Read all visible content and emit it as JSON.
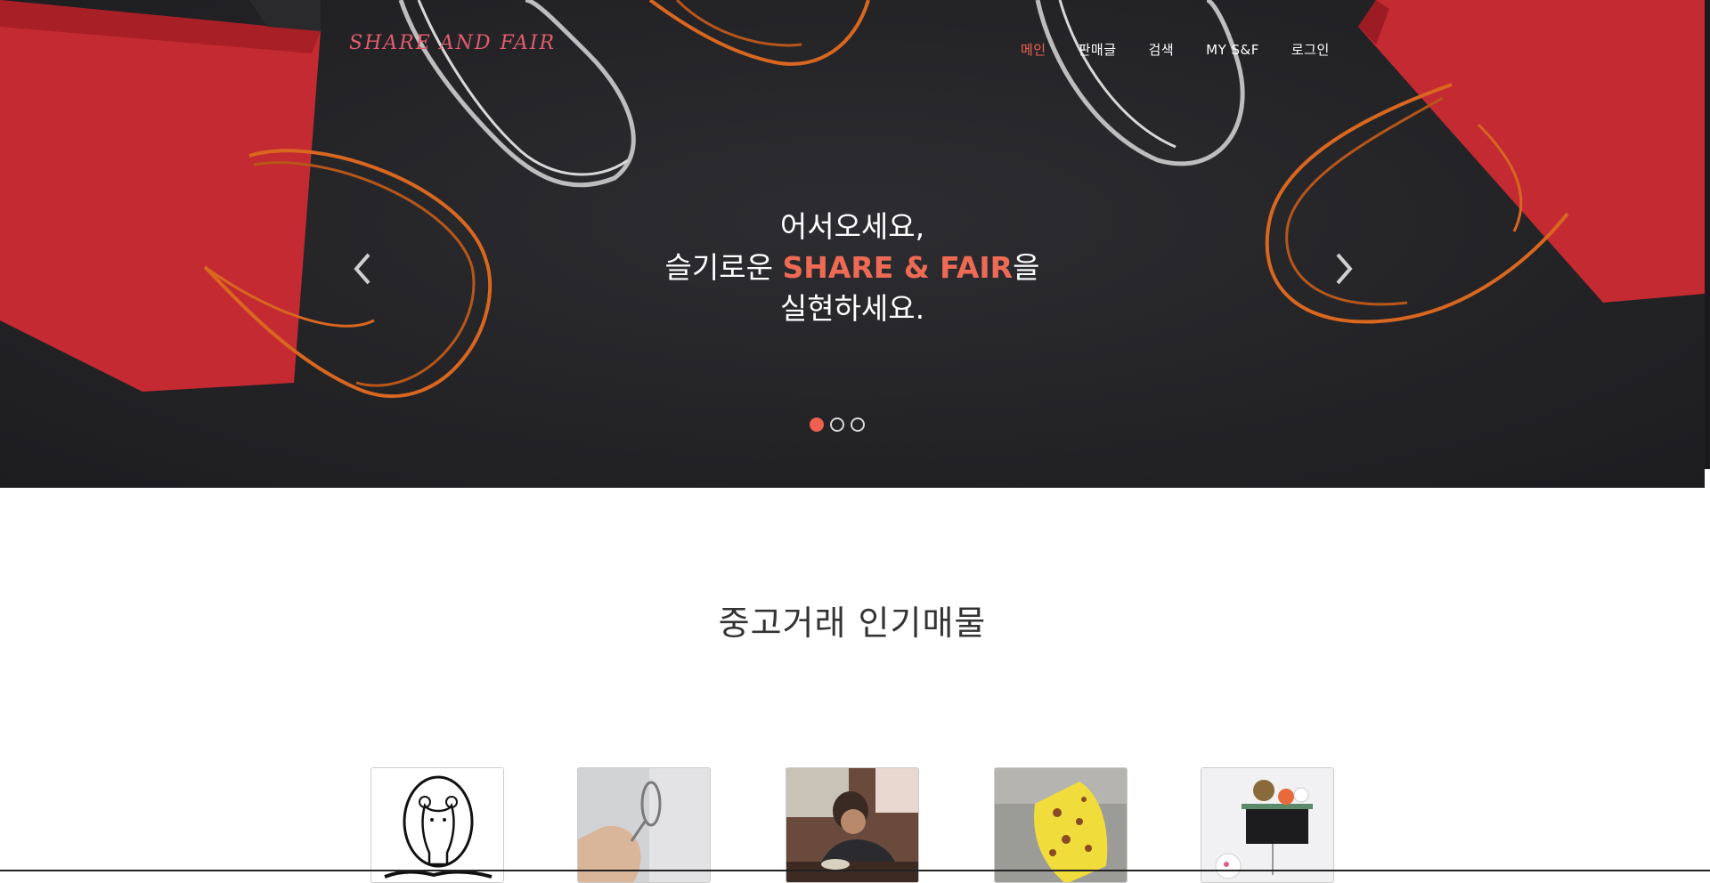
{
  "navbar": {
    "brand": "SHARE AND FAIR",
    "items": [
      {
        "label": "메인",
        "active": true
      },
      {
        "label": "판매글",
        "active": false
      },
      {
        "label": "검색",
        "active": false
      },
      {
        "label": "MY S&F",
        "active": false
      },
      {
        "label": "로그인",
        "active": false
      }
    ]
  },
  "hero": {
    "line1": "어서오세요,",
    "line2_prefix": "슬기로운 ",
    "line2_accent": "SHARE & FAIR",
    "line2_suffix": "을",
    "line3": "실현하세요.",
    "slides_count": 3,
    "active_slide": 1,
    "prev_icon": "chevron-left-icon",
    "next_icon": "chevron-right-icon"
  },
  "popular": {
    "title": "중고거래 인기매물",
    "items": [
      {
        "image": "bear-logo-sticker"
      },
      {
        "image": "metal-ring-in-hand"
      },
      {
        "image": "person-eating-at-table"
      },
      {
        "image": "yellow-cheese-toy"
      },
      {
        "image": "plush-toys-on-tv-shelf"
      }
    ]
  },
  "colors": {
    "accent": "#ee6150",
    "brand": "#e35b6f",
    "hero_bg": "#242427"
  }
}
